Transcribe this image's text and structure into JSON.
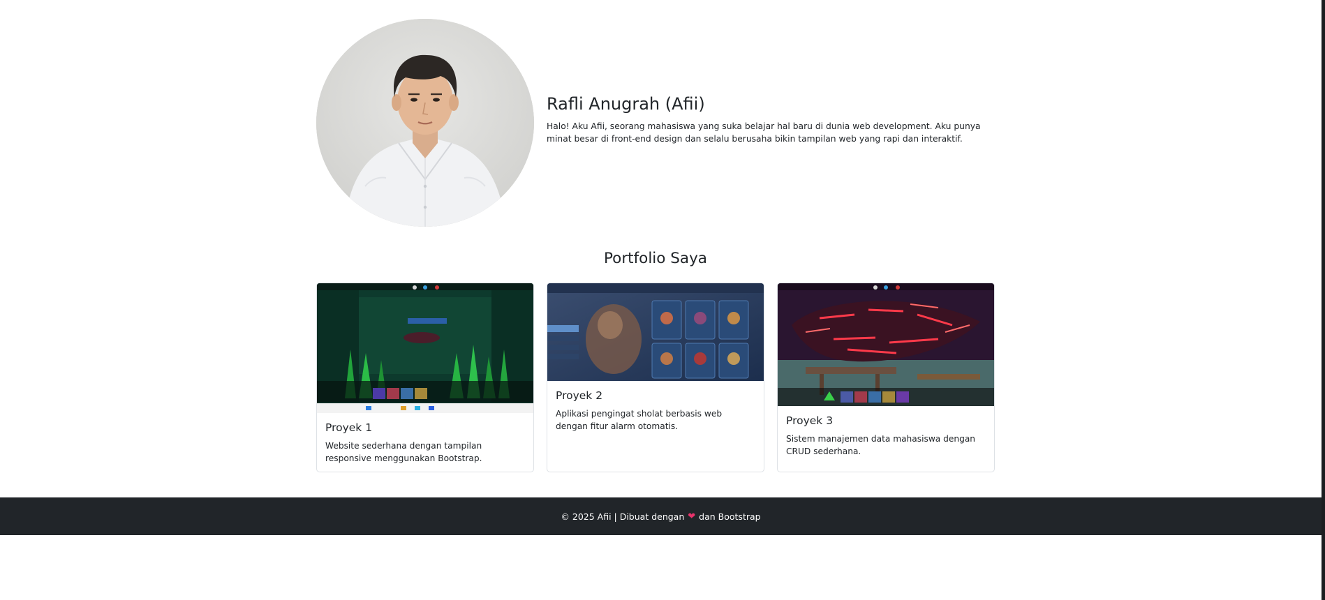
{
  "profile": {
    "name": "Rafli Anugrah (Afii)",
    "bio": "Halo! Aku Afii, seorang mahasiswa yang suka belajar hal baru di dunia web development. Aku punya minat besar di front-end design dan selalu berusaha bikin tampilan web yang rapi dan interaktif."
  },
  "portfolio": {
    "title": "Portfolio Saya",
    "projects": [
      {
        "title": "Proyek 1",
        "description": "Website sederhana dengan tampilan responsive menggunakan Bootstrap."
      },
      {
        "title": "Proyek 2",
        "description": "Aplikasi pengingat sholat berbasis web dengan fitur alarm otomatis."
      },
      {
        "title": "Proyek 3",
        "description": "Sistem manajemen data mahasiswa dengan CRUD sederhana."
      }
    ]
  },
  "footer": {
    "prefix": "© 2025 Afii | Dibuat dengan",
    "heart_icon": "heart-icon",
    "suffix": "dan Bootstrap"
  },
  "colors": {
    "footer_bg": "#212529",
    "heart": "#e8336b",
    "text": "#212529"
  }
}
